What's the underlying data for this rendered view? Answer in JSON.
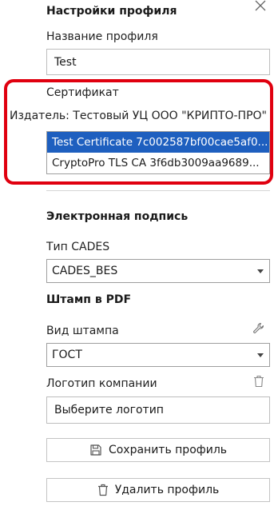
{
  "profile_settings": {
    "title": "Настройки профиля",
    "name_label": "Название профиля",
    "name_value": "Test"
  },
  "certificate": {
    "label": "Сертификат",
    "issuer": "Издатель: Тестовый УЦ ООО \"КРИПТО-ПРО\"",
    "items": [
      {
        "label": "Test Certificate 7c002587bf00cae5af0...",
        "selected": true
      },
      {
        "label": "CryptoPro TLS CA 3f6db3009aa9689...",
        "selected": false
      }
    ]
  },
  "signature": {
    "title": "Электронная подпись",
    "cades_type_label": "Тип CADES",
    "cades_type_value": "CADES_BES"
  },
  "stamp": {
    "title": "Штамп в PDF",
    "type_label": "Вид штампа",
    "type_value": "ГОСТ",
    "logo_label": "Логотип компании",
    "logo_placeholder": "Выберите логотип"
  },
  "buttons": {
    "save": "Сохранить профиль",
    "delete": "Удалить профиль"
  },
  "colors": {
    "highlight": "#e0000f",
    "selection": "#1e5fbf"
  },
  "icons": {
    "close": "close-icon",
    "wrench": "wrench-icon",
    "trash": "trash-icon",
    "save": "floppy-disk-icon"
  }
}
